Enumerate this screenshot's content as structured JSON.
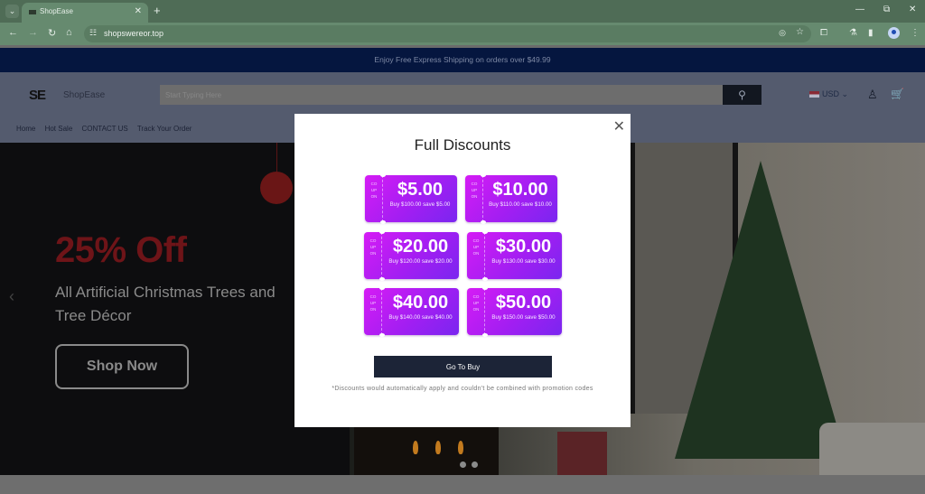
{
  "browser": {
    "tab_title": "ShopEase",
    "url": "shopswereor.top",
    "icons": {
      "tab_menu": "chevron-down-icon",
      "tab_close": "close-icon",
      "new_tab": "plus-icon",
      "back": "arrow-left-icon",
      "forward": "arrow-right-icon",
      "reload": "reload-icon",
      "home": "home-icon",
      "site_info": "tune-icon",
      "tracking": "eye-off-icon",
      "bookmark": "star-icon",
      "extensions": "puzzle-icon",
      "labs": "flask-icon",
      "sidepanel": "sidepanel-icon",
      "profile": "profile-icon",
      "menu": "kebab-menu-icon",
      "minimize": "minimize-icon",
      "restore": "restore-icon",
      "close_window": "close-icon"
    }
  },
  "site": {
    "promo_bar": "Enjoy Free Express Shipping on orders over $49.99",
    "logo": "SE",
    "brand": "ShopEase",
    "search": {
      "placeholder": "Start Typing Here",
      "value": ""
    },
    "currency": "USD",
    "nav": [
      "Home",
      "Hot Sale",
      "CONTACT US",
      "Track Your Order"
    ]
  },
  "hero": {
    "title": "25% Off",
    "subtitle": "All Artificial Christmas Trees and Tree Décor",
    "cta": "Shop Now",
    "slide_count": 2,
    "active_slide": 1
  },
  "modal": {
    "title": "Full Discounts",
    "coupon_stub": "COUPON",
    "coupons": [
      {
        "amount": "$5.00",
        "desc": "Buy $100.00 save $5.00"
      },
      {
        "amount": "$10.00",
        "desc": "Buy $110.00 save $10.00"
      },
      {
        "amount": "$20.00",
        "desc": "Buy $120.00 save $20.00"
      },
      {
        "amount": "$30.00",
        "desc": "Buy $130.00 save $30.00"
      },
      {
        "amount": "$40.00",
        "desc": "Buy $140.00 save $40.00"
      },
      {
        "amount": "$50.00",
        "desc": "Buy $150.00 save $50.00"
      }
    ],
    "button": "Go To Buy",
    "disclaimer": "*Discounts would automatically apply and couldn't be combined with promotion codes"
  },
  "colors": {
    "promo_bg": "#05163f",
    "coupon_start": "#d51cf5",
    "coupon_end": "#7a26f0",
    "button_bg": "#1c2437",
    "hero_title": "#6e1418"
  }
}
